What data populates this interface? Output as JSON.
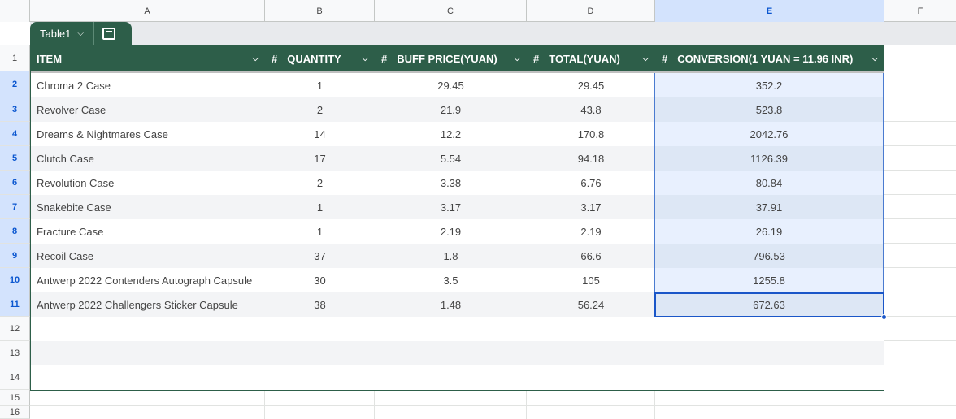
{
  "columns": [
    "A",
    "B",
    "C",
    "D",
    "E",
    "F"
  ],
  "selected_column": "E",
  "row_numbers": [
    "1",
    "2",
    "3",
    "4",
    "5",
    "6",
    "7",
    "8",
    "9",
    "10",
    "11",
    "12",
    "13",
    "14",
    "15",
    "16"
  ],
  "table": {
    "name": "Table1",
    "headers": [
      {
        "label": "ITEM",
        "typed": false
      },
      {
        "label": "QUANTITY",
        "typed": true
      },
      {
        "label": "BUFF PRICE(YUAN)",
        "typed": true
      },
      {
        "label": "TOTAL(YUAN)",
        "typed": true
      },
      {
        "label": "CONVERSION(1 YUAN = 11.96 INR)",
        "typed": true
      }
    ],
    "number_type_symbol": "#",
    "rows": [
      [
        "Chroma 2 Case",
        "1",
        "29.45",
        "29.45",
        "352.2"
      ],
      [
        "Revolver Case",
        "2",
        "21.9",
        "43.8",
        "523.8"
      ],
      [
        "Dreams & Nightmares Case",
        "14",
        "12.2",
        "170.8",
        "2042.76"
      ],
      [
        "Clutch Case",
        "17",
        "5.54",
        "94.18",
        "1126.39"
      ],
      [
        "Revolution Case",
        "2",
        "3.38",
        "6.76",
        "80.84"
      ],
      [
        "Snakebite Case",
        "1",
        "3.17",
        "3.17",
        "37.91"
      ],
      [
        "Fracture Case",
        "1",
        "2.19",
        "2.19",
        "26.19"
      ],
      [
        "Recoil Case",
        "37",
        "1.8",
        "66.6",
        "796.53"
      ],
      [
        "Antwerp 2022 Contenders Autograph Capsule",
        "30",
        "3.5",
        "105",
        "1255.8"
      ],
      [
        "Antwerp 2022 Challengers Sticker Capsule",
        "38",
        "1.48",
        "56.24",
        "672.63"
      ]
    ]
  },
  "colors": {
    "table_header": "#2d5e49",
    "selection": "#1a56c8",
    "column_selected_bg": "#d3e3fd"
  },
  "icons": {
    "dropdown": "chevron-down-icon",
    "calculator": "calculator-icon"
  }
}
